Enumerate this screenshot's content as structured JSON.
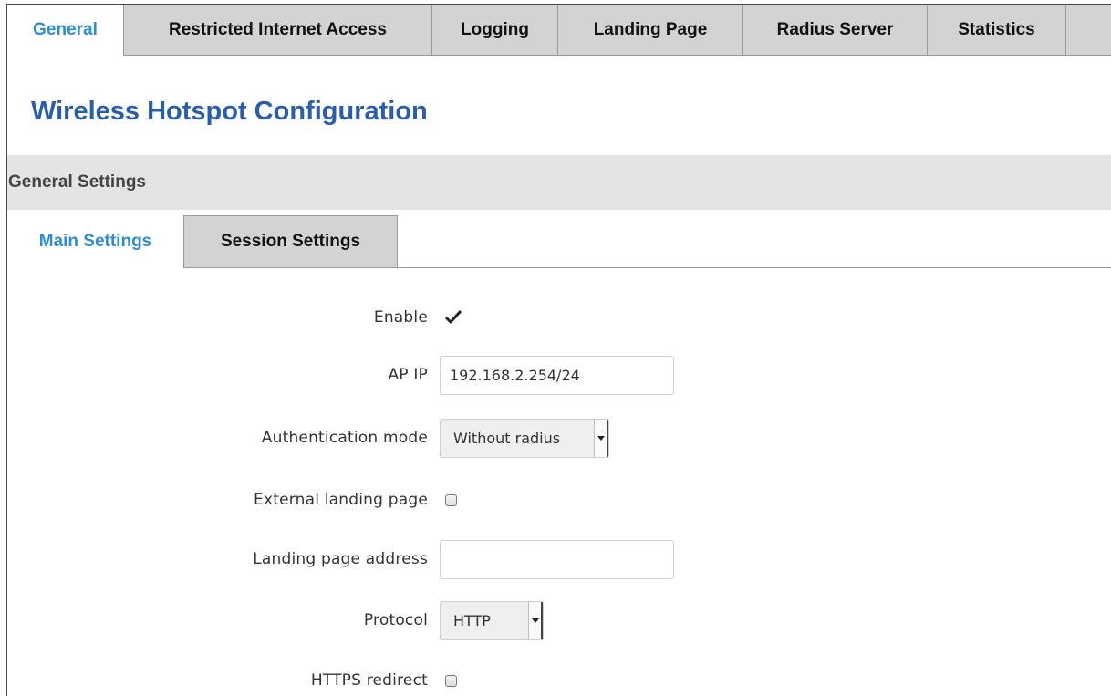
{
  "top_tabs": [
    {
      "label": "General",
      "active": true
    },
    {
      "label": "Restricted Internet Access",
      "active": false
    },
    {
      "label": "Logging",
      "active": false
    },
    {
      "label": "Landing Page",
      "active": false
    },
    {
      "label": "Radius Server",
      "active": false
    },
    {
      "label": "Statistics",
      "active": false
    }
  ],
  "page_title": "Wireless Hotspot Configuration",
  "section_header": "General Settings",
  "sub_tabs": [
    {
      "label": "Main Settings",
      "active": true
    },
    {
      "label": "Session Settings",
      "active": false
    }
  ],
  "form": {
    "enable": {
      "label": "Enable",
      "checked": true
    },
    "ap_ip": {
      "label": "AP IP",
      "value": "192.168.2.254/24"
    },
    "auth_mode": {
      "label": "Authentication mode",
      "value": "Without radius"
    },
    "external_landing": {
      "label": "External landing page",
      "checked": false
    },
    "landing_address": {
      "label": "Landing page address",
      "value": ""
    },
    "protocol": {
      "label": "Protocol",
      "value": "HTTP"
    },
    "https_redirect": {
      "label": "HTTPS redirect",
      "checked": false
    }
  },
  "colors": {
    "accent": "#2f8dd0",
    "title": "#2a5ea8",
    "inactive_tab": "#d3d3d3",
    "section_bg": "#e4e4e4"
  }
}
